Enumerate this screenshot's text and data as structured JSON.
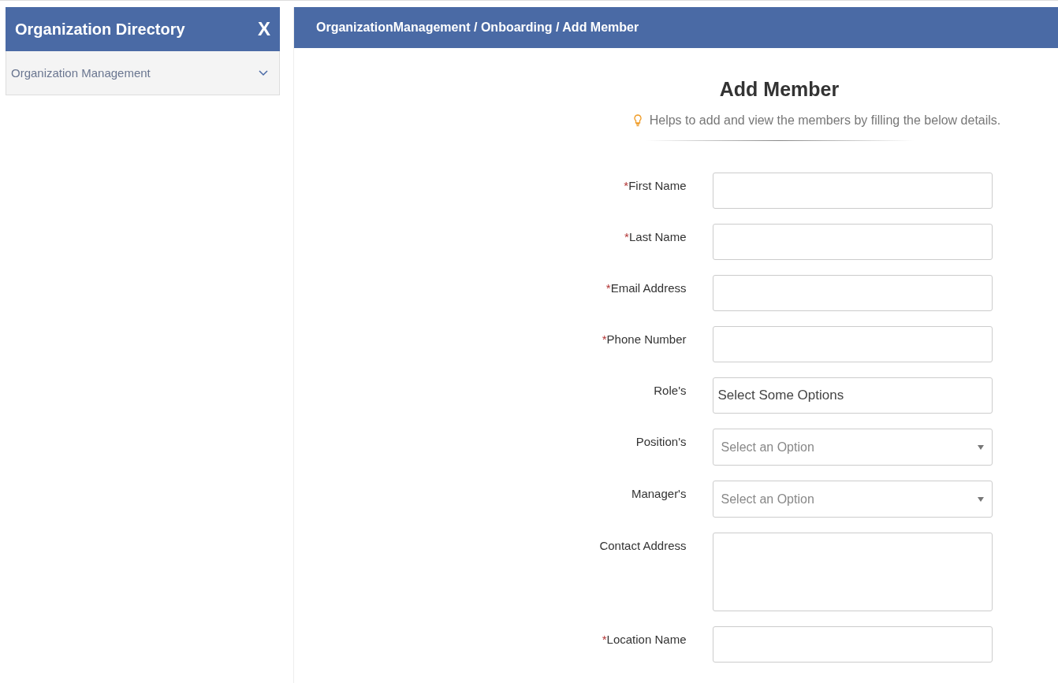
{
  "sidebar": {
    "title": "Organization Directory",
    "close_label": "X",
    "items": [
      {
        "label": "Organization Management",
        "expanded": false
      }
    ]
  },
  "breadcrumb": "OrganizationManagement / Onboarding / Add Member",
  "form": {
    "title": "Add Member",
    "hint": "Helps to add and view the members by filling the below details.",
    "fields": [
      {
        "kind": "text",
        "label": "First Name",
        "required_mark": "*"
      },
      {
        "kind": "text",
        "label": "Last Name",
        "required_mark": "*"
      },
      {
        "kind": "text",
        "label": "Email Address",
        "required_mark": "*"
      },
      {
        "kind": "text",
        "label": "Phone Number",
        "required_mark": "*"
      },
      {
        "kind": "multiselect",
        "label": "Role's",
        "placeholder": "Select Some Options"
      },
      {
        "kind": "select",
        "label": "Position's",
        "placeholder": "Select an Option"
      },
      {
        "kind": "select",
        "label": "Manager's",
        "placeholder": "Select an Option"
      },
      {
        "kind": "textarea",
        "label": "Contact Address"
      },
      {
        "kind": "text",
        "label": "Location Name",
        "required_mark": "*"
      }
    ]
  }
}
